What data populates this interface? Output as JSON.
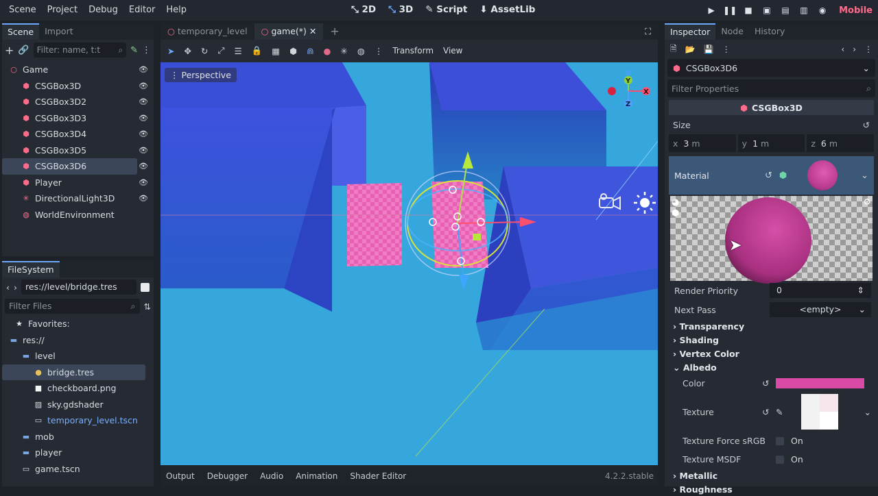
{
  "menu": [
    "Scene",
    "Project",
    "Debug",
    "Editor",
    "Help"
  ],
  "modes": [
    {
      "label": "2D",
      "active": false
    },
    {
      "label": "3D",
      "active": true
    },
    {
      "label": "Script",
      "active": false
    },
    {
      "label": "AssetLib",
      "active": false
    }
  ],
  "renderer": "Mobile",
  "scene_panel": {
    "tabs": [
      "Scene",
      "Import"
    ],
    "filter_placeholder": "Filter: name, t:t",
    "nodes": [
      {
        "name": "Game",
        "icon": "node3d-icon",
        "depth": 0
      },
      {
        "name": "CSGBox3D",
        "icon": "csgbox-icon",
        "depth": 1
      },
      {
        "name": "CSGBox3D2",
        "icon": "csgbox-icon",
        "depth": 1
      },
      {
        "name": "CSGBox3D3",
        "icon": "csgbox-icon",
        "depth": 1
      },
      {
        "name": "CSGBox3D4",
        "icon": "csgbox-icon",
        "depth": 1
      },
      {
        "name": "CSGBox3D5",
        "icon": "csgbox-icon",
        "depth": 1
      },
      {
        "name": "CSGBox3D6",
        "icon": "csgbox-icon",
        "depth": 1,
        "selected": true
      },
      {
        "name": "Player",
        "icon": "player-icon",
        "depth": 1
      },
      {
        "name": "DirectionalLight3D",
        "icon": "light-icon",
        "depth": 1
      },
      {
        "name": "WorldEnvironment",
        "icon": "world-icon",
        "depth": 1
      }
    ]
  },
  "filesystem": {
    "title": "FileSystem",
    "path": "res://level/bridge.tres",
    "filter_placeholder": "Filter Files",
    "items": [
      {
        "name": "Favorites:",
        "depth": 0,
        "icon": "star-icon"
      },
      {
        "name": "res://",
        "depth": 0,
        "icon": "folder-icon"
      },
      {
        "name": "level",
        "depth": 1,
        "icon": "folder-icon"
      },
      {
        "name": "bridge.tres",
        "depth": 2,
        "icon": "material-icon",
        "selected": true
      },
      {
        "name": "checkboard.png",
        "depth": 2,
        "icon": "image-icon"
      },
      {
        "name": "sky.gdshader",
        "depth": 2,
        "icon": "shader-icon"
      },
      {
        "name": "temporary_level.tscn",
        "depth": 2,
        "icon": "scene-icon",
        "blue": true
      },
      {
        "name": "mob",
        "depth": 1,
        "icon": "folder-icon"
      },
      {
        "name": "player",
        "depth": 1,
        "icon": "folder-icon"
      },
      {
        "name": "game.tscn",
        "depth": 1,
        "icon": "scene-icon"
      }
    ]
  },
  "viewport": {
    "tabs": [
      {
        "label": "temporary_level",
        "active": false
      },
      {
        "label": "game(*)",
        "active": true
      }
    ],
    "toolbar_text": [
      "Transform",
      "View"
    ],
    "perspective": "Perspective",
    "bottom_tabs": [
      "Output",
      "Debugger",
      "Audio",
      "Animation",
      "Shader Editor"
    ],
    "version": "4.2.2.stable",
    "gizmo_axes": [
      "Y",
      "X",
      "Z"
    ]
  },
  "inspector": {
    "tabs": [
      "Inspector",
      "Node",
      "History"
    ],
    "object": "CSGBox3D6",
    "filter_placeholder": "Filter Properties",
    "class_header": "CSGBox3D",
    "size_label": "Size",
    "size": {
      "x": "3",
      "y": "1",
      "z": "6",
      "unit": "m"
    },
    "material_label": "Material",
    "render_priority_label": "Render Priority",
    "render_priority": "0",
    "next_pass_label": "Next Pass",
    "next_pass": "<empty>",
    "sections": [
      "Transparency",
      "Shading",
      "Vertex Color",
      "Albedo"
    ],
    "albedo_color_label": "Color",
    "albedo_color": "#d94aa6",
    "texture_label": "Texture",
    "texture_force_srgb_label": "Texture Force sRGB",
    "texture_msdf_label": "Texture MSDF",
    "on_label": "On",
    "bottom_sections": [
      "Metallic",
      "Roughness"
    ]
  },
  "colors": {
    "accent": "#6fa8ff",
    "pink": "#e66ab8",
    "sky": "#36a7dc",
    "box": "#2e48d6"
  }
}
